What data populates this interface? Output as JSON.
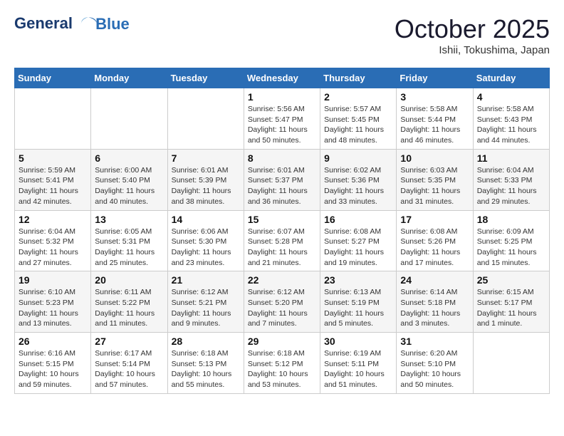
{
  "header": {
    "logo_line1": "General",
    "logo_line2": "Blue",
    "month": "October 2025",
    "location": "Ishii, Tokushima, Japan"
  },
  "weekdays": [
    "Sunday",
    "Monday",
    "Tuesday",
    "Wednesday",
    "Thursday",
    "Friday",
    "Saturday"
  ],
  "weeks": [
    [
      {
        "day": "",
        "info": ""
      },
      {
        "day": "",
        "info": ""
      },
      {
        "day": "",
        "info": ""
      },
      {
        "day": "1",
        "info": "Sunrise: 5:56 AM\nSunset: 5:47 PM\nDaylight: 11 hours\nand 50 minutes."
      },
      {
        "day": "2",
        "info": "Sunrise: 5:57 AM\nSunset: 5:45 PM\nDaylight: 11 hours\nand 48 minutes."
      },
      {
        "day": "3",
        "info": "Sunrise: 5:58 AM\nSunset: 5:44 PM\nDaylight: 11 hours\nand 46 minutes."
      },
      {
        "day": "4",
        "info": "Sunrise: 5:58 AM\nSunset: 5:43 PM\nDaylight: 11 hours\nand 44 minutes."
      }
    ],
    [
      {
        "day": "5",
        "info": "Sunrise: 5:59 AM\nSunset: 5:41 PM\nDaylight: 11 hours\nand 42 minutes."
      },
      {
        "day": "6",
        "info": "Sunrise: 6:00 AM\nSunset: 5:40 PM\nDaylight: 11 hours\nand 40 minutes."
      },
      {
        "day": "7",
        "info": "Sunrise: 6:01 AM\nSunset: 5:39 PM\nDaylight: 11 hours\nand 38 minutes."
      },
      {
        "day": "8",
        "info": "Sunrise: 6:01 AM\nSunset: 5:37 PM\nDaylight: 11 hours\nand 36 minutes."
      },
      {
        "day": "9",
        "info": "Sunrise: 6:02 AM\nSunset: 5:36 PM\nDaylight: 11 hours\nand 33 minutes."
      },
      {
        "day": "10",
        "info": "Sunrise: 6:03 AM\nSunset: 5:35 PM\nDaylight: 11 hours\nand 31 minutes."
      },
      {
        "day": "11",
        "info": "Sunrise: 6:04 AM\nSunset: 5:33 PM\nDaylight: 11 hours\nand 29 minutes."
      }
    ],
    [
      {
        "day": "12",
        "info": "Sunrise: 6:04 AM\nSunset: 5:32 PM\nDaylight: 11 hours\nand 27 minutes."
      },
      {
        "day": "13",
        "info": "Sunrise: 6:05 AM\nSunset: 5:31 PM\nDaylight: 11 hours\nand 25 minutes."
      },
      {
        "day": "14",
        "info": "Sunrise: 6:06 AM\nSunset: 5:30 PM\nDaylight: 11 hours\nand 23 minutes."
      },
      {
        "day": "15",
        "info": "Sunrise: 6:07 AM\nSunset: 5:28 PM\nDaylight: 11 hours\nand 21 minutes."
      },
      {
        "day": "16",
        "info": "Sunrise: 6:08 AM\nSunset: 5:27 PM\nDaylight: 11 hours\nand 19 minutes."
      },
      {
        "day": "17",
        "info": "Sunrise: 6:08 AM\nSunset: 5:26 PM\nDaylight: 11 hours\nand 17 minutes."
      },
      {
        "day": "18",
        "info": "Sunrise: 6:09 AM\nSunset: 5:25 PM\nDaylight: 11 hours\nand 15 minutes."
      }
    ],
    [
      {
        "day": "19",
        "info": "Sunrise: 6:10 AM\nSunset: 5:23 PM\nDaylight: 11 hours\nand 13 minutes."
      },
      {
        "day": "20",
        "info": "Sunrise: 6:11 AM\nSunset: 5:22 PM\nDaylight: 11 hours\nand 11 minutes."
      },
      {
        "day": "21",
        "info": "Sunrise: 6:12 AM\nSunset: 5:21 PM\nDaylight: 11 hours\nand 9 minutes."
      },
      {
        "day": "22",
        "info": "Sunrise: 6:12 AM\nSunset: 5:20 PM\nDaylight: 11 hours\nand 7 minutes."
      },
      {
        "day": "23",
        "info": "Sunrise: 6:13 AM\nSunset: 5:19 PM\nDaylight: 11 hours\nand 5 minutes."
      },
      {
        "day": "24",
        "info": "Sunrise: 6:14 AM\nSunset: 5:18 PM\nDaylight: 11 hours\nand 3 minutes."
      },
      {
        "day": "25",
        "info": "Sunrise: 6:15 AM\nSunset: 5:17 PM\nDaylight: 11 hours\nand 1 minute."
      }
    ],
    [
      {
        "day": "26",
        "info": "Sunrise: 6:16 AM\nSunset: 5:15 PM\nDaylight: 10 hours\nand 59 minutes."
      },
      {
        "day": "27",
        "info": "Sunrise: 6:17 AM\nSunset: 5:14 PM\nDaylight: 10 hours\nand 57 minutes."
      },
      {
        "day": "28",
        "info": "Sunrise: 6:18 AM\nSunset: 5:13 PM\nDaylight: 10 hours\nand 55 minutes."
      },
      {
        "day": "29",
        "info": "Sunrise: 6:18 AM\nSunset: 5:12 PM\nDaylight: 10 hours\nand 53 minutes."
      },
      {
        "day": "30",
        "info": "Sunrise: 6:19 AM\nSunset: 5:11 PM\nDaylight: 10 hours\nand 51 minutes."
      },
      {
        "day": "31",
        "info": "Sunrise: 6:20 AM\nSunset: 5:10 PM\nDaylight: 10 hours\nand 50 minutes."
      },
      {
        "day": "",
        "info": ""
      }
    ]
  ]
}
